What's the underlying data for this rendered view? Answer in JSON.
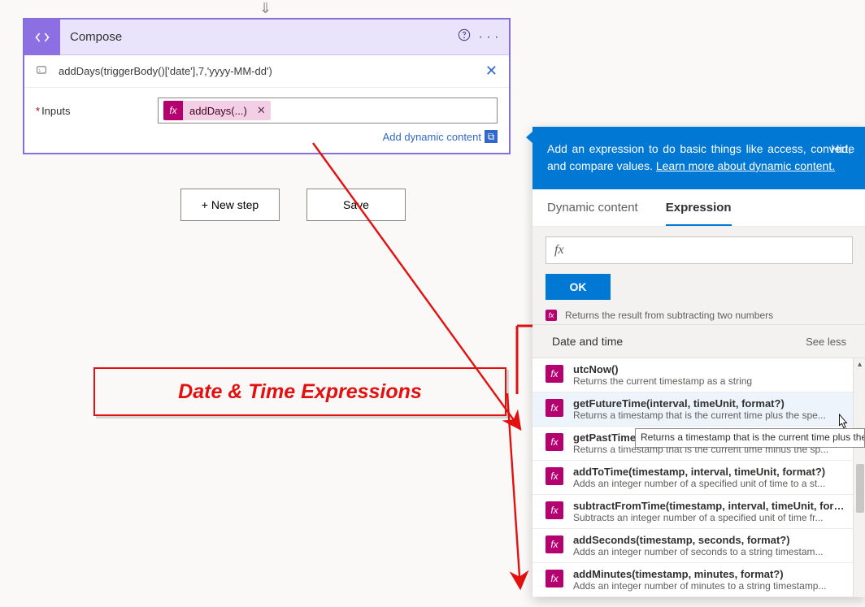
{
  "arrowTop": "⇓",
  "card": {
    "title": "Compose",
    "expression": "addDays(triggerBody()['date'],7,'yyyy-MM-dd')",
    "inputsLabel": "Inputs",
    "token": {
      "fx": "fx",
      "text": "addDays(...)"
    },
    "dynamicLink": "Add dynamic content"
  },
  "buttons": {
    "newStep": "+ New step",
    "save": "Save"
  },
  "callout": "Date & Time Expressions",
  "panel": {
    "headText": "Add an expression to do basic things like access, convert, and compare values. ",
    "headLink": "Learn more about dynamic content.",
    "hide": "Hide",
    "tabs": {
      "dynamic": "Dynamic content",
      "expression": "Expression"
    },
    "fxLabel": "fx",
    "ok": "OK",
    "truncated": "Returns the result from subtracting two numbers",
    "category": "Date and time",
    "seeLess": "See less",
    "funcs": [
      {
        "sig": "utcNow()",
        "desc": "Returns the current timestamp as a string"
      },
      {
        "sig": "getFutureTime(interval, timeUnit, format?)",
        "desc": "Returns a timestamp that is the current time plus the spe..."
      },
      {
        "sig": "getPastTime(in",
        "desc": "Returns a timestamp that is the current time minus the sp..."
      },
      {
        "sig": "addToTime(timestamp, interval, timeUnit, format?)",
        "desc": "Adds an integer number of a specified unit of time to a st..."
      },
      {
        "sig": "subtractFromTime(timestamp, interval, timeUnit, forma...",
        "desc": "Subtracts an integer number of a specified unit of time fr..."
      },
      {
        "sig": "addSeconds(timestamp, seconds, format?)",
        "desc": "Adds an integer number of seconds to a string timestam..."
      },
      {
        "sig": "addMinutes(timestamp, minutes, format?)",
        "desc": "Adds an integer number of minutes to a string timestamp..."
      }
    ],
    "tooltip": "Returns a timestamp that is the current time plus the"
  }
}
